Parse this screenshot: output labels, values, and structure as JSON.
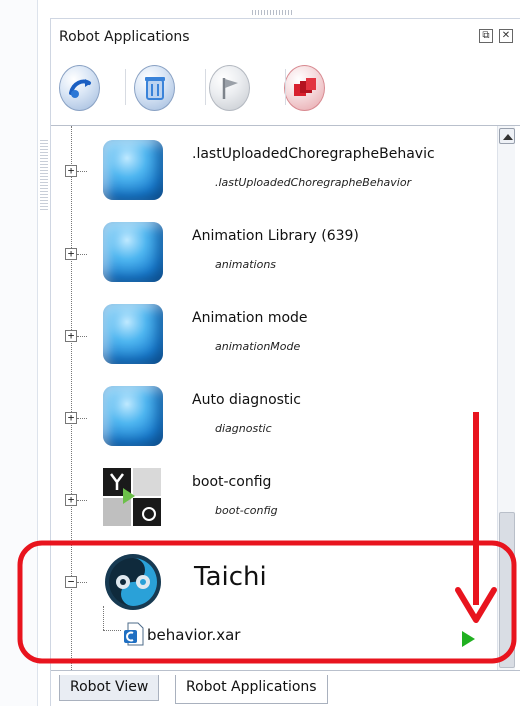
{
  "panel": {
    "title": "Robot Applications"
  },
  "title_buttons": [
    {
      "glyph": "⧉",
      "icon": "float-window-icon"
    },
    {
      "glyph": "✕",
      "icon": "close-icon"
    }
  ],
  "toolbar": {
    "buttons": [
      {
        "icon": "upload-behavior-icon",
        "color": "#2b77d6"
      },
      {
        "icon": "delete-icon",
        "color": "#3a83d9"
      },
      {
        "icon": "set-default-flag-icon",
        "color": "#9aa0a8"
      },
      {
        "icon": "stop-all-icon",
        "color": "#d8202e"
      }
    ]
  },
  "tree": {
    "items": [
      {
        "name": ".lastUploadedChoregrapheBehavic",
        "sub": ".lastUploadedChoregrapheBehavior",
        "icon": "cube-icon",
        "expander": "+"
      },
      {
        "name": "Animation Library (639)",
        "sub": "animations",
        "icon": "cube-icon",
        "expander": "+"
      },
      {
        "name": "Animation mode",
        "sub": "animationMode",
        "icon": "cube-icon",
        "expander": "+"
      },
      {
        "name": "Auto diagnostic",
        "sub": "diagnostic",
        "icon": "cube-icon",
        "expander": "+"
      },
      {
        "name": "boot-config",
        "sub": "boot-config",
        "icon": "boot-config-icon",
        "expander": "+"
      }
    ],
    "expanded": {
      "name": "Taichi",
      "icon": "taichi-icon",
      "expander": "−",
      "child": {
        "name": "behavior.xar",
        "icon": "behavior-file-icon"
      }
    }
  },
  "tabs": [
    "Robot View",
    "Robot Applications"
  ],
  "colors": {
    "annotation": "#e8141e",
    "play": "#21b021"
  }
}
